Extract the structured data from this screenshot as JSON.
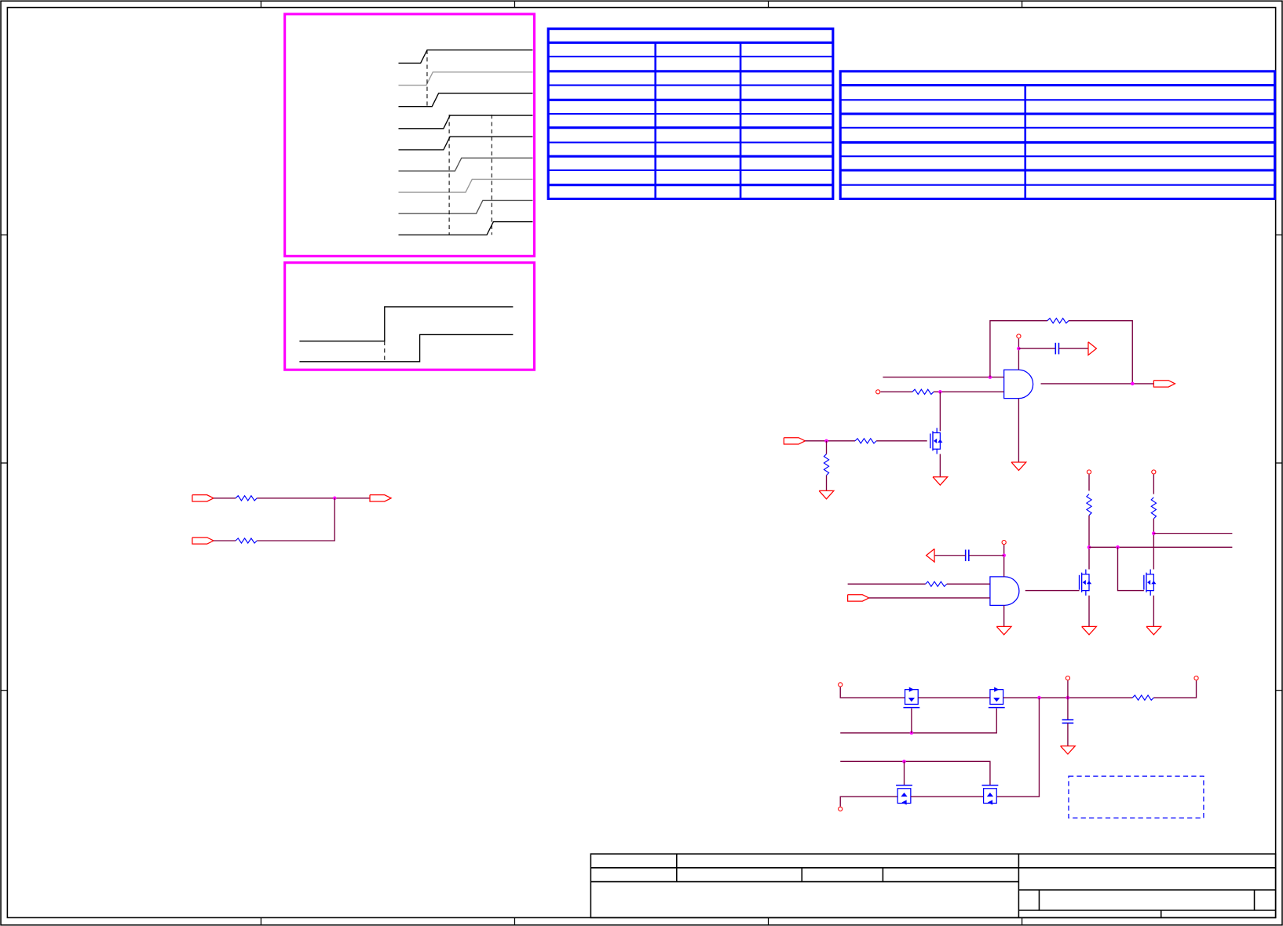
{
  "sheet": {
    "colors": {
      "frame": "#000000",
      "timing_box": "#ff00ff",
      "table": "#0000ff",
      "wire": "#7a0040",
      "pin": "#ff0000",
      "component": "#0000ff",
      "junction": "#ff00ff",
      "signal_dark": "#000000",
      "signal_gray": "#999999"
    },
    "icons": [
      "resistor-icon",
      "capacitor-icon",
      "ground-icon",
      "power-pin-icon",
      "port-arrow-icon",
      "and-gate-icon",
      "mosfet-icon"
    ]
  }
}
